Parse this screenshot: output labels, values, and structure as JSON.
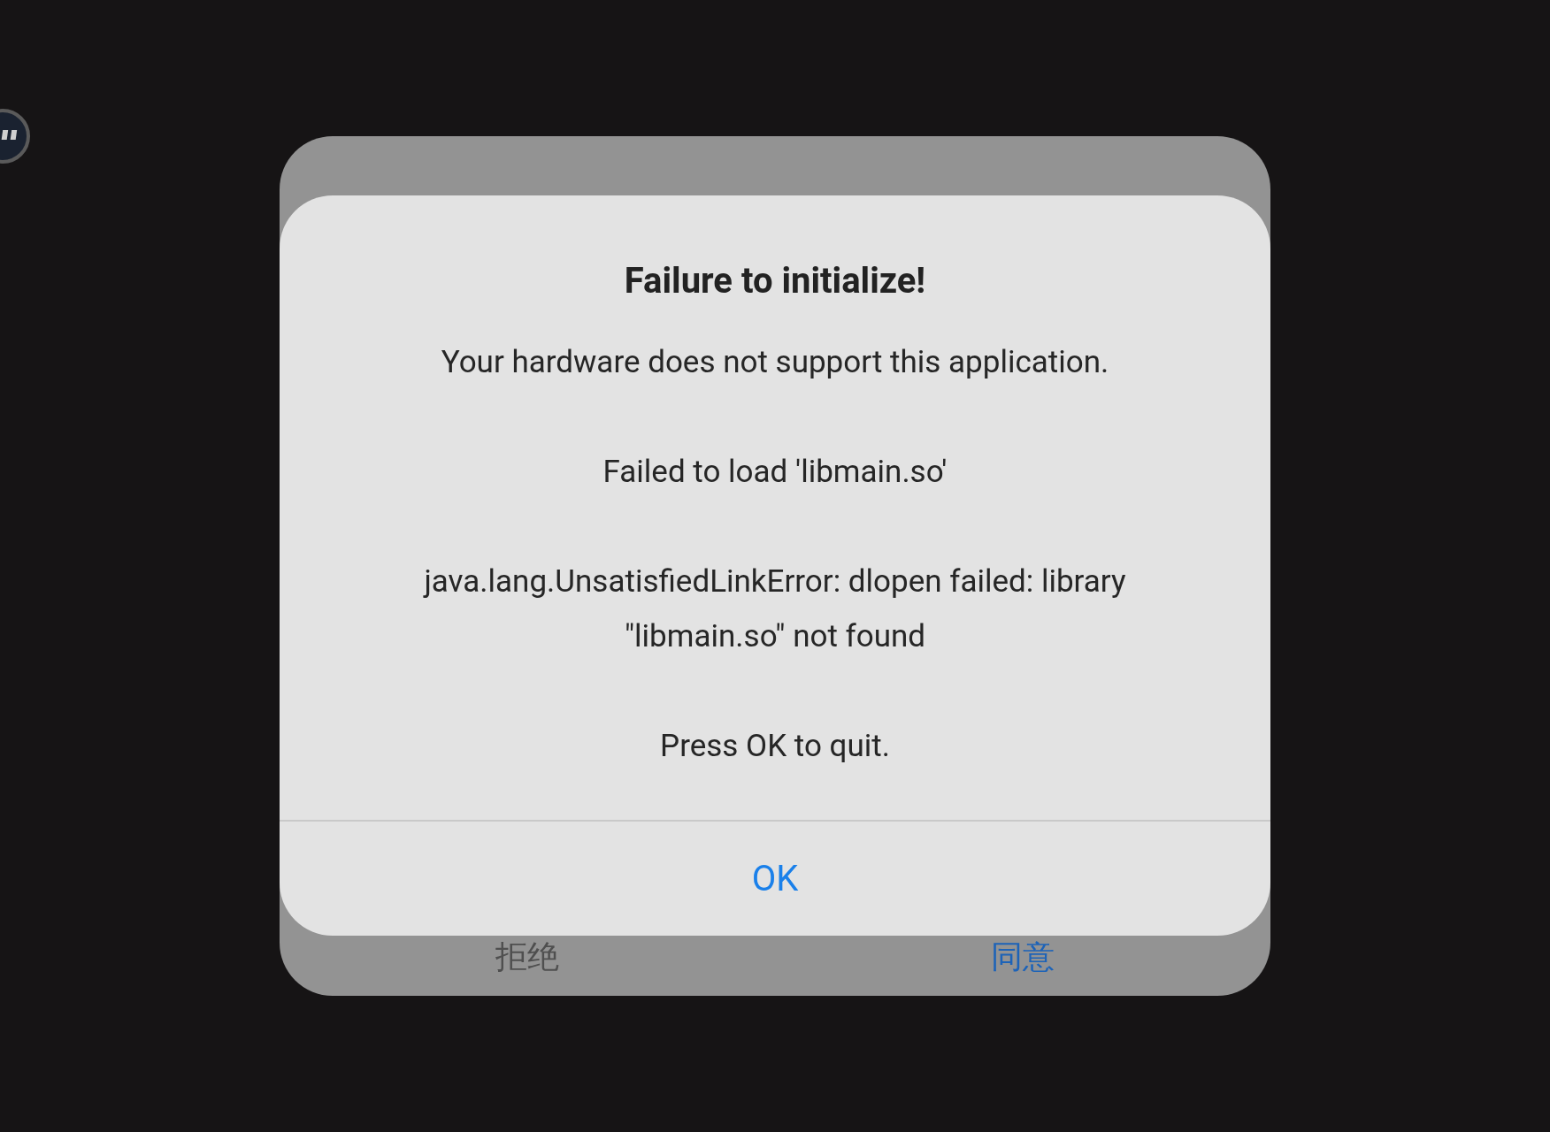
{
  "back_dialog": {
    "buttons": [
      {
        "label": "拒绝",
        "kind": "neutral"
      },
      {
        "label": "同意",
        "kind": "primary"
      }
    ]
  },
  "dialog": {
    "title": "Failure to initialize!",
    "paragraphs": [
      "Your hardware does not support this application.",
      "Failed to load 'libmain.so'",
      "java.lang.UnsatisfiedLinkError: dlopen failed: library \"libmain.so\" not found",
      "Press OK to quit."
    ],
    "button": "OK"
  }
}
